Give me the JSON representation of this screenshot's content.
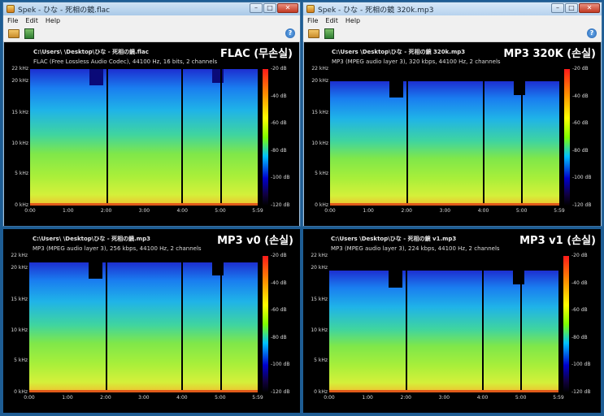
{
  "windows": [
    {
      "title": "Spek - ひな - 死相の鏡.flac",
      "menu": [
        "File",
        "Edit",
        "Help"
      ],
      "path": "C:\\Users\\                    \\Desktop\\ひな - 死相の鏡.flac",
      "info": "FLAC (Free Lossless Audio Codec), 44100 Hz, 16 bits, 2 channels",
      "overlay": "FLAC (무손실)"
    },
    {
      "title": "Spek - ひな - 死相の鏡 320k.mp3",
      "menu": [
        "File",
        "Edit",
        "Help"
      ],
      "path": "C:\\Users                      \\Desktop\\ひな - 死相の鏡 320k.mp3",
      "info": "MP3 (MPEG audio layer 3), 320 kbps, 44100 Hz, 2 channels",
      "overlay": "MP3 320K (손실)"
    },
    {
      "path": "C:\\Users\\                    \\Desktop\\ひな - 死相の鏡.mp3",
      "info": "MP3 (MPEG audio layer 3), 256 kbps, 44100 Hz, 2 channels",
      "overlay": "MP3 v0 (손실)"
    },
    {
      "path": "C:\\Users                      \\Desktop\\ひな - 死相の鏡 v1.mp3",
      "info": "MP3 (MPEG audio layer 3), 224 kbps, 44100 Hz, 2 channels",
      "overlay": "MP3 v1 (손실)"
    }
  ],
  "axes": {
    "freq_ticks": [
      "22 kHz",
      "20 kHz",
      "15 kHz",
      "10 kHz",
      "5 kHz",
      "0 kHz"
    ],
    "time_ticks": [
      "0:00",
      "1:00",
      "2:00",
      "3:00",
      "4:00",
      "5:00",
      "5:59"
    ],
    "db_ticks": [
      "-20 dB",
      "-40 dB",
      "-60 dB",
      "-80 dB",
      "-100 dB",
      "-120 dB"
    ]
  },
  "window_controls": {
    "minimize": "–",
    "maximize": "□",
    "close": "✕"
  },
  "help_glyph": "?",
  "colors": {
    "desktop": "#1e5d94",
    "spectrum_bg": "#000000"
  }
}
